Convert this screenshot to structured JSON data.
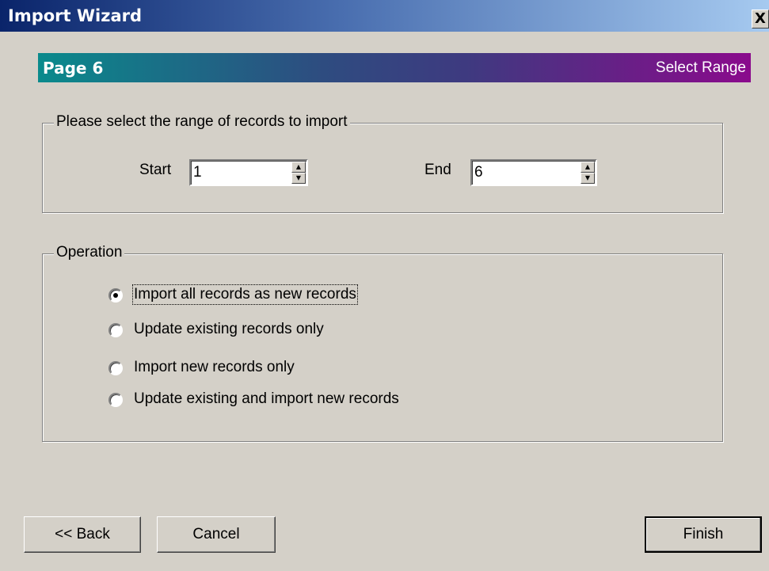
{
  "window": {
    "title": "Import Wizard",
    "close_label": "X"
  },
  "banner": {
    "page": "Page 6",
    "step": "Select Range"
  },
  "range": {
    "legend": "Please select the range of records to import",
    "start_label": "Start",
    "start_value": "1",
    "end_label": "End",
    "end_value": "6"
  },
  "operation": {
    "legend": "Operation",
    "options": [
      {
        "label": "Import all records as new records",
        "selected": true
      },
      {
        "label": "Update existing records only",
        "selected": false
      },
      {
        "label": "Import new records only",
        "selected": false
      },
      {
        "label": "Update existing and import new records",
        "selected": false
      }
    ]
  },
  "buttons": {
    "back": "<< Back",
    "cancel": "Cancel",
    "finish": "Finish"
  },
  "colors": {
    "face": "#d4d0c8",
    "title_start": "#0a246a",
    "title_end": "#a6caf0"
  }
}
